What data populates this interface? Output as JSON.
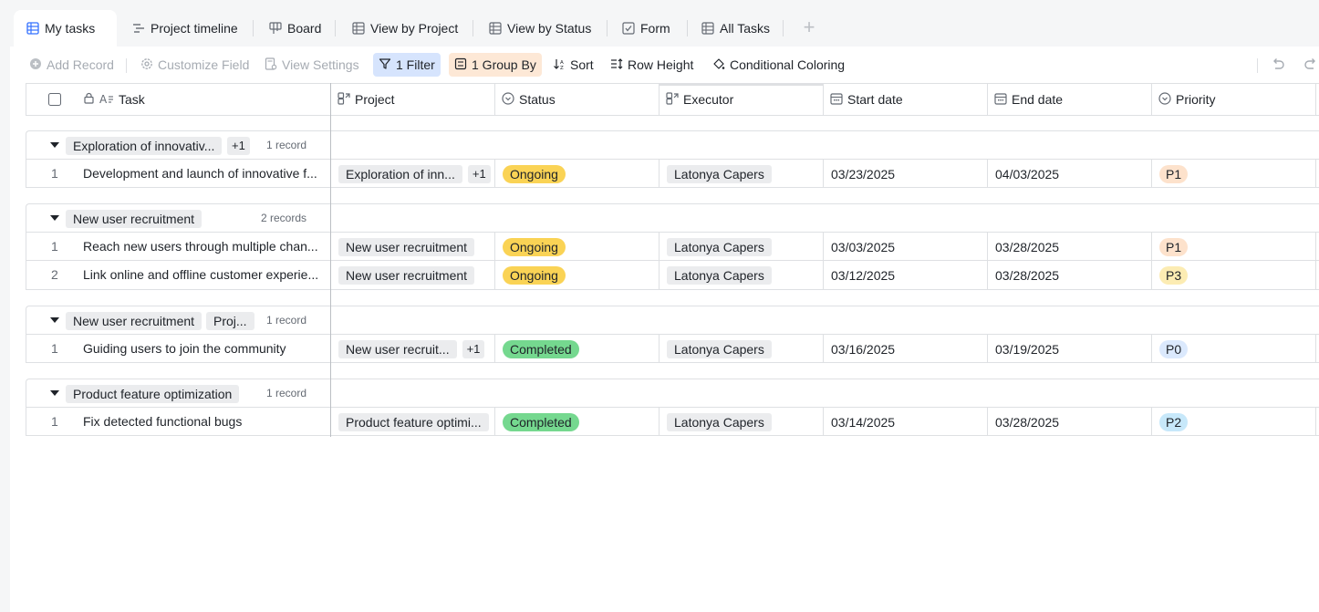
{
  "tabs": [
    {
      "label": "My tasks",
      "icon": "grid-table-icon",
      "active": true
    },
    {
      "label": "Project timeline",
      "icon": "gantt-icon"
    },
    {
      "label": "Board",
      "icon": "kanban-icon"
    },
    {
      "label": "View by Project",
      "icon": "grid-table-icon"
    },
    {
      "label": "View by Status",
      "icon": "grid-table-icon"
    },
    {
      "label": "Form",
      "icon": "form-icon"
    },
    {
      "label": "All Tasks",
      "icon": "grid-table-icon"
    }
  ],
  "toolbar": {
    "add_record": "Add Record",
    "customize_field": "Customize Field",
    "view_settings": "View Settings",
    "filter": "1 Filter",
    "group_by": "1 Group By",
    "sort": "Sort",
    "row_height": "Row Height",
    "conditional_coloring": "Conditional Coloring"
  },
  "columns": {
    "task": "Task",
    "project": "Project",
    "status": "Status",
    "executor": "Executor",
    "start_date": "Start date",
    "end_date": "End date",
    "priority": "Priority"
  },
  "colors": {
    "ongoing": "#fad355",
    "completed": "#75d88f",
    "p0": "#dbe9fd",
    "p1": "#fde2cc",
    "p2": "#c7e8fa",
    "p3": "#fcecb3"
  },
  "groups": [
    {
      "tag": "Exploration of innovativ...",
      "extra": "+1",
      "count": "1 record",
      "rows": [
        {
          "num": "1",
          "task": "Development and launch of innovative f...",
          "project": "Exploration of inn...",
          "project_extra": "+1",
          "status": "Ongoing",
          "executor": "Latonya Capers",
          "start": "03/23/2025",
          "end": "04/03/2025",
          "priority": "P1"
        }
      ]
    },
    {
      "tag": "New user recruitment",
      "extra": "",
      "count": "2 records",
      "rows": [
        {
          "num": "1",
          "task": "Reach new users through multiple chan...",
          "project": "New user recruitment",
          "project_extra": "",
          "status": "Ongoing",
          "executor": "Latonya Capers",
          "start": "03/03/2025",
          "end": "03/28/2025",
          "priority": "P1"
        },
        {
          "num": "2",
          "task": "Link online and offline customer experie...",
          "project": "New user recruitment",
          "project_extra": "",
          "status": "Ongoing",
          "executor": "Latonya Capers",
          "start": "03/12/2025",
          "end": "03/28/2025",
          "priority": "P3"
        }
      ]
    },
    {
      "tag": "New user recruitment",
      "extra": "Proj...",
      "count": "1 record",
      "rows": [
        {
          "num": "1",
          "task": "Guiding users to join the community",
          "project": "New user recruit...",
          "project_extra": "+1",
          "status": "Completed",
          "executor": "Latonya Capers",
          "start": "03/16/2025",
          "end": "03/19/2025",
          "priority": "P0"
        }
      ]
    },
    {
      "tag": "Product feature optimization",
      "extra": "",
      "count": "1 record",
      "rows": [
        {
          "num": "1",
          "task": "Fix detected functional bugs",
          "project": "Product feature optimi...",
          "project_extra": "",
          "status": "Completed",
          "executor": "Latonya Capers",
          "start": "03/14/2025",
          "end": "03/28/2025",
          "priority": "P2"
        }
      ]
    }
  ]
}
